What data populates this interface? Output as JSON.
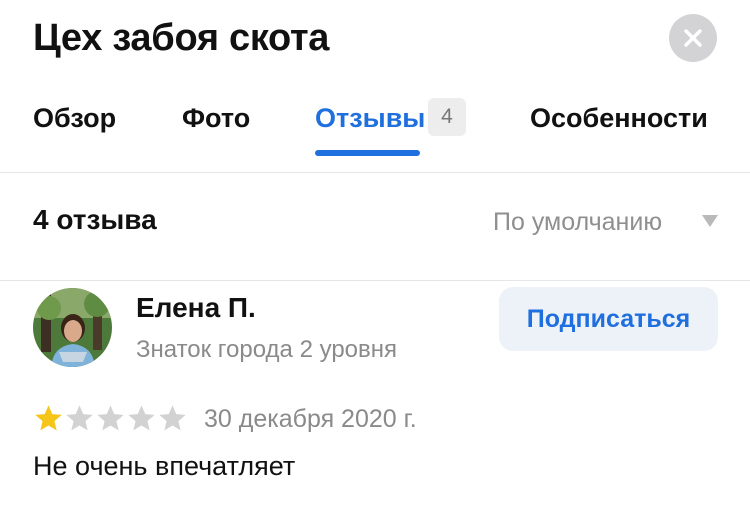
{
  "header": {
    "title": "Цех забоя скота"
  },
  "tabs": [
    {
      "label": "Обзор",
      "active": false
    },
    {
      "label": "Фото",
      "active": false
    },
    {
      "label": "Отзывы",
      "active": true,
      "badge": "4"
    },
    {
      "label": "Особенности",
      "active": false
    }
  ],
  "reviews": {
    "count_label": "4 отзыва",
    "sort_label": "По умолчанию"
  },
  "review": {
    "author_name": "Елена П.",
    "author_level": "Знаток города 2 уровня",
    "subscribe_label": "Подписаться",
    "rating": 1,
    "rating_max": 5,
    "date": "30 декабря 2020 г.",
    "text": "Не очень впечатляет"
  },
  "colors": {
    "accent": "#1f6fde",
    "star_filled": "#f5c518",
    "star_empty": "#d2d2d2"
  },
  "icons": {
    "close": "close-icon",
    "sort": "chevron-down-icon",
    "star": "star-icon"
  }
}
